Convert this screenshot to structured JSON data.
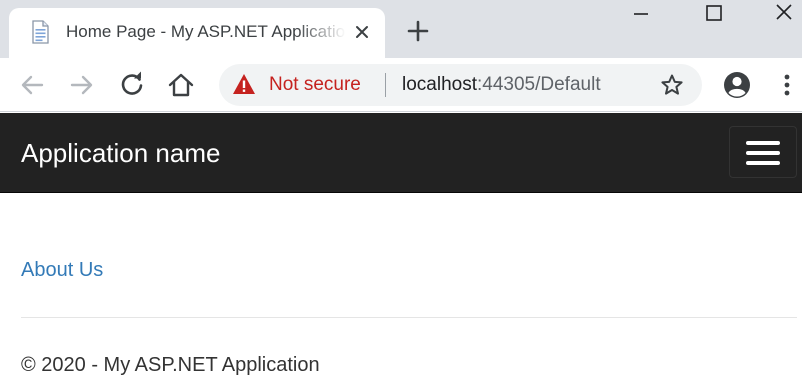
{
  "tab": {
    "title": "Home Page - My ASP.NET Application",
    "favicon": "document-icon"
  },
  "toolbar": {
    "security_label": "Not secure",
    "url_host": "localhost",
    "url_rest": ":44305/Default"
  },
  "navbar": {
    "brand": "Application name"
  },
  "main": {
    "about_link": "About Us"
  },
  "footer": {
    "text": "© 2020 - My ASP.NET Application"
  },
  "colors": {
    "navbar_bg": "#222222",
    "link": "#337ab7",
    "warning": "#c5221f",
    "tabstrip": "#dee1e6"
  }
}
